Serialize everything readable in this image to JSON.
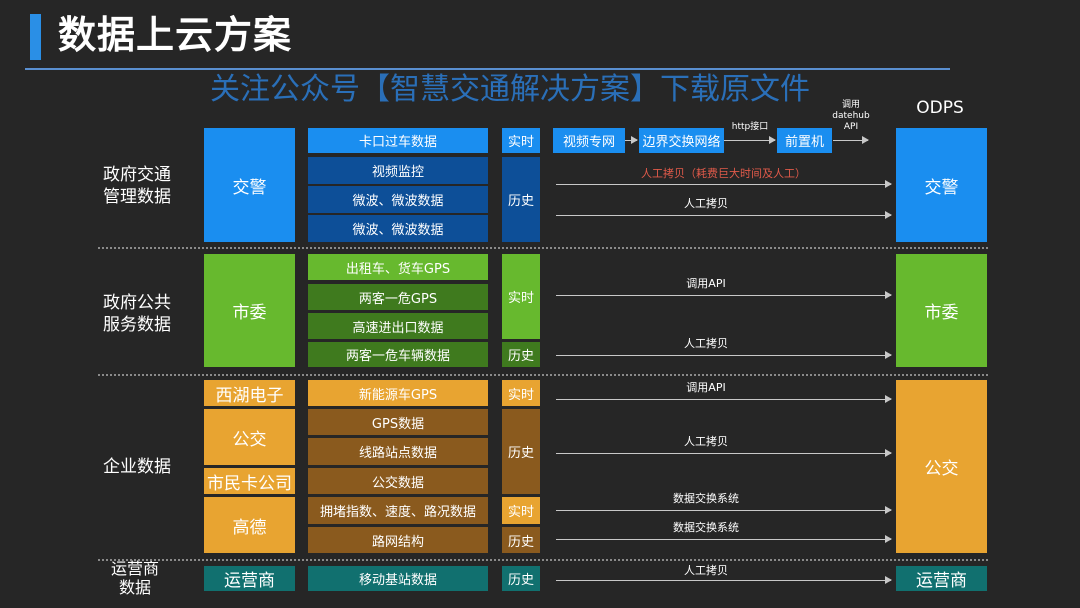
{
  "header": {
    "title": "数据上云方案",
    "subtitle": "关注公众号【智慧交通解决方案】下载原文件"
  },
  "odps_label": "ODPS",
  "categories": {
    "gov_traffic": "政府交通\n管理数据",
    "gov_public": "政府公共\n服务数据",
    "enterprise": "企业数据",
    "operator": "运营商\n数据"
  },
  "sources": {
    "jiaojing": "交警",
    "shiwei": "市委",
    "xihu": "西湖电子",
    "gongjiao": "公交",
    "shiminka": "市民卡公司",
    "gaode": "高德",
    "operator": "运营商"
  },
  "items": {
    "kakou": "卡口过车数据",
    "video": "视频监控",
    "microwave1": "微波、微波数据",
    "microwave2": "微波、微波数据",
    "taxi": "出租车、货车GPS",
    "liangke1": "两客一危GPS",
    "highway": "高速进出口数据",
    "liangke2": "两客一危车辆数据",
    "newenergy": "新能源车GPS",
    "gps": "GPS数据",
    "route": "线路站点数据",
    "bus": "公交数据",
    "congestion": "拥堵指数、速度、路况数据",
    "network": "路网结构",
    "basestation": "移动基站数据"
  },
  "tags": {
    "realtime": "实时",
    "history": "历史"
  },
  "flow": {
    "video_net": "视频专网",
    "border": "边界交换网络",
    "http": "http接口",
    "frontend": "前置机",
    "datehub": "调用\ndatehub\nAPI"
  },
  "arrows": {
    "manual_costly": "人工拷贝（耗费巨大时间及人工）",
    "manual": "人工拷贝",
    "api": "调用API",
    "exchange": "数据交换系统"
  },
  "colors": {
    "blue": "#1a8ef0",
    "dark_blue": "#0d4f98",
    "green": "#67b92e",
    "dark_green": "#3f7a1e",
    "orange": "#e8a431",
    "brown": "#8a5a1e",
    "teal": "#11706f",
    "warning_text": "#e05a4a"
  }
}
